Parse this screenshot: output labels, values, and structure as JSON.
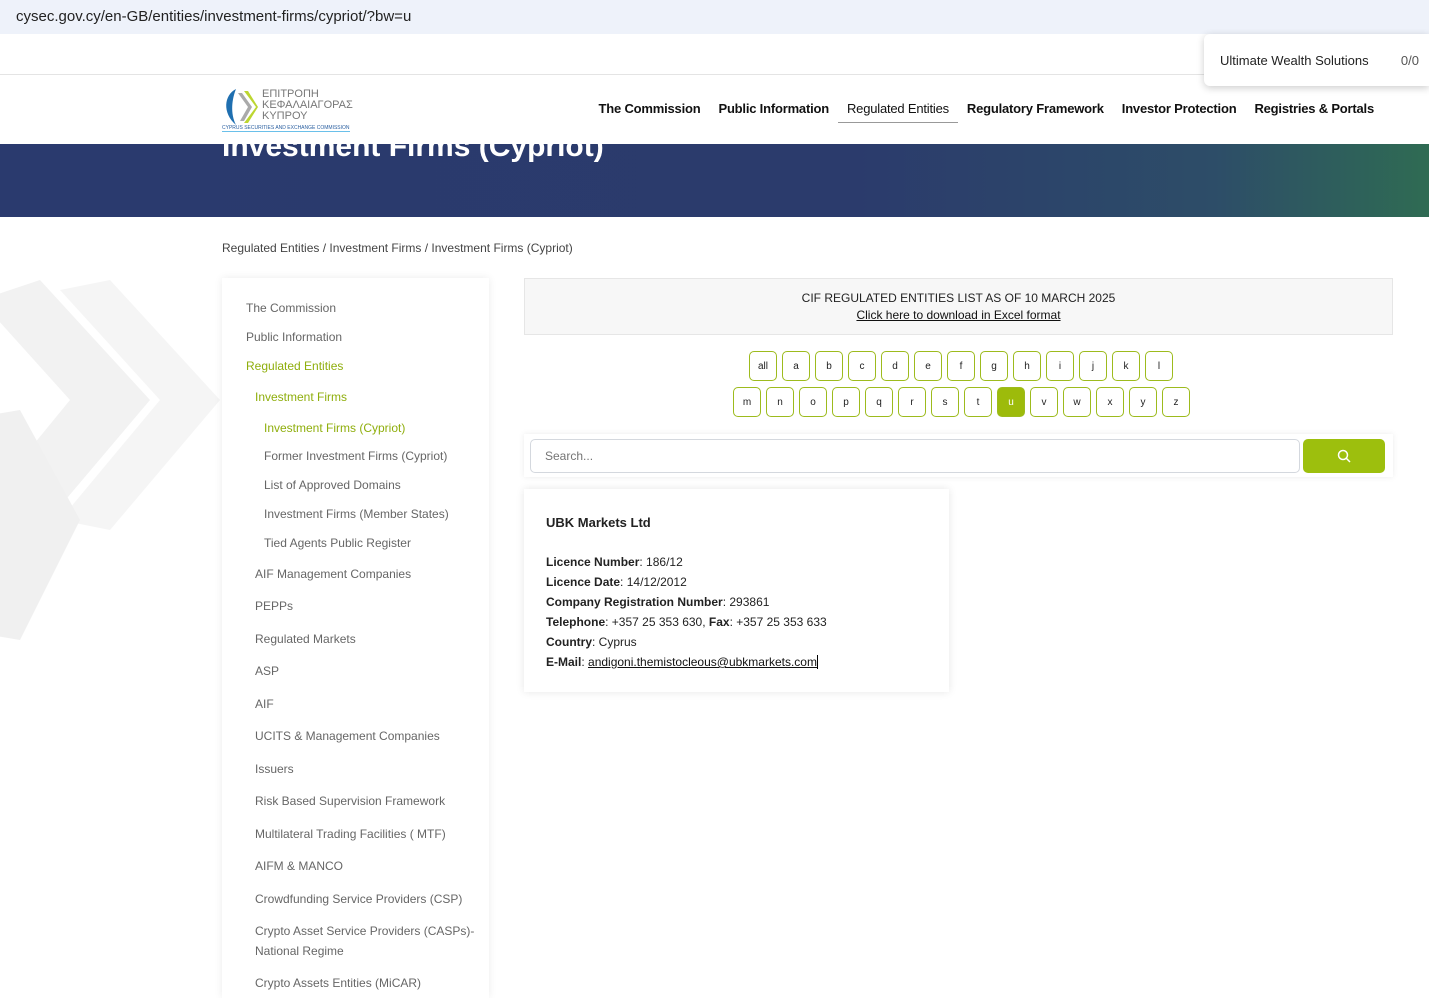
{
  "browser": {
    "url": "cysec.gov.cy/en-GB/entities/investment-firms/cypriot/?bw=u"
  },
  "find": {
    "query": "Ultimate Wealth Solutions",
    "count": "0/0"
  },
  "logo": {
    "line1": "ΕΠΙΤΡΟΠΗ",
    "line2": "ΚΕΦΑΛΑΙΑΓΟΡΑΣ",
    "line3": "ΚΥΠΡΟΥ",
    "sub": "CYPRUS SECURITIES AND EXCHANGE COMMISSION"
  },
  "nav": [
    "The Commission",
    "Public Information",
    "Regulated Entities",
    "Regulatory Framework",
    "Investor Protection",
    "Registries & Portals"
  ],
  "page_title": "Investment Firms (Cypriot)",
  "breadcrumb": "Regulated Entities / Investment Firms / Investment Firms (Cypriot)",
  "sidebar": [
    "The Commission",
    "Public Information",
    "Regulated Entities",
    "Investment Firms",
    "Investment Firms (Cypriot)",
    "Former Investment Firms (Cypriot)",
    "List of Approved Domains",
    "Investment Firms (Member States)",
    "Tied Agents Public Register",
    "AIF Management Companies",
    "PEPPs",
    "Regulated Markets",
    "ASP",
    "AIF",
    "UCITS & Management Companies",
    "Issuers",
    "Risk Based Supervision Framework",
    "Multilateral Trading Facilities ( MTF)",
    "AIFM & MANCO",
    "Crowdfunding Service Providers (CSP)",
    "Crypto Asset Service Providers (CASPs)-",
    "National Regime",
    "Crypto Assets Entities (MiCAR)"
  ],
  "cif": {
    "title": "CIF REGULATED ENTITIES LIST AS OF 10 MARCH 2025",
    "link": "Click here to download in Excel format"
  },
  "letters_row1": [
    "all",
    "a",
    "b",
    "c",
    "d",
    "e",
    "f",
    "g",
    "h",
    "i",
    "j",
    "k",
    "l"
  ],
  "letters_row2": [
    "m",
    "n",
    "o",
    "p",
    "q",
    "r",
    "s",
    "t",
    "u",
    "v",
    "w",
    "x",
    "y",
    "z"
  ],
  "selected_letter": "u",
  "search": {
    "placeholder": "Search..."
  },
  "entity": {
    "name": "UBK Markets Ltd",
    "licence_number_label": "Licence Number",
    "licence_number": "186/12",
    "licence_date_label": "Licence Date",
    "licence_date": "14/12/2012",
    "reg_label": "Company Registration Number",
    "reg": "293861",
    "tel_label": "Telephone",
    "tel": "+357 25 353 630",
    "fax_label": "Fax",
    "fax": "+357 25 353 633",
    "country_label": "Country",
    "country": "Cyprus",
    "email_label": "E-Mail",
    "email": "andigoni.themistocleous@ubkmarkets.com"
  },
  "colors": {
    "accent": "#9dbf0d",
    "banner": "#2a3a6e"
  }
}
